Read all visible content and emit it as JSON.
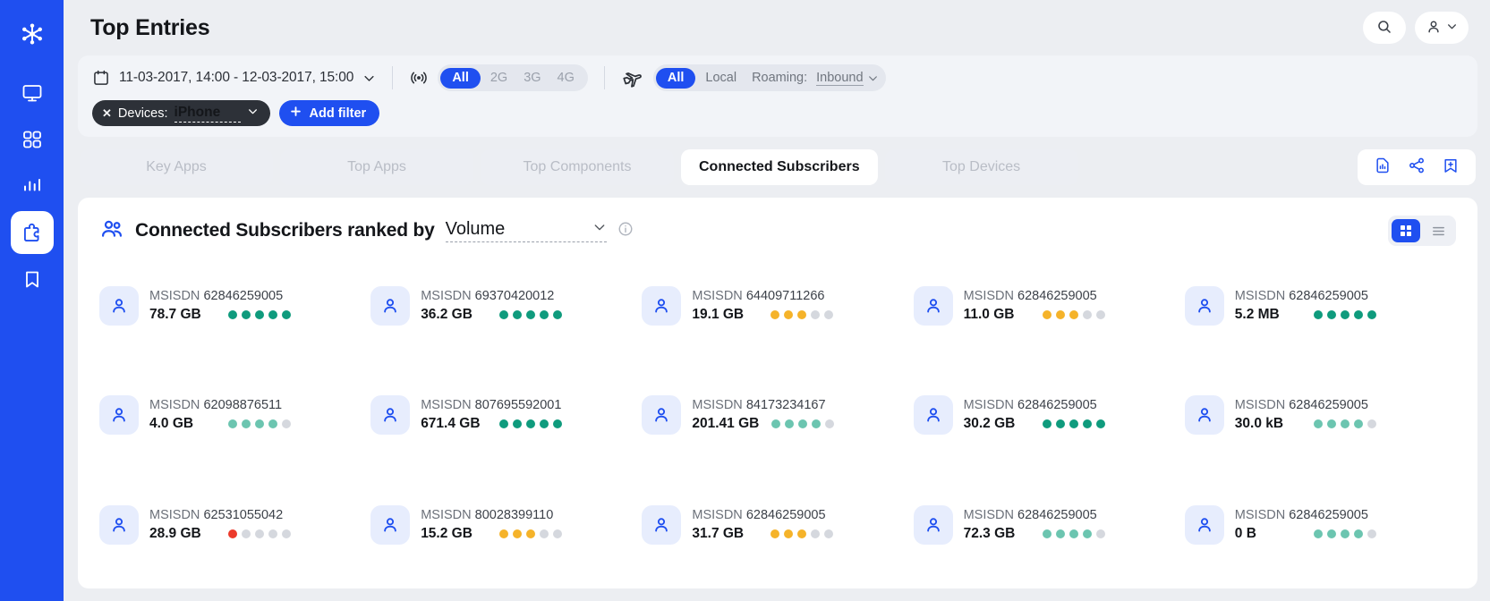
{
  "colors": {
    "brand": "#1f4ff0",
    "dot_green": "#0f9b7d",
    "dot_teal": "#6cc5b0",
    "dot_orange": "#f5b32a",
    "dot_red": "#ec3a2b",
    "dot_grey": "#d5d8de"
  },
  "rail": {
    "items": [
      {
        "name": "logo",
        "icon": "network-logo-icon"
      },
      {
        "name": "monitor",
        "icon": "monitor-icon"
      },
      {
        "name": "dashboard",
        "icon": "dashboard-grid-icon"
      },
      {
        "name": "analytics",
        "icon": "bar-chart-icon"
      },
      {
        "name": "top-entries",
        "icon": "puzzle-icon"
      },
      {
        "name": "bookmarks",
        "icon": "bookmark-icon"
      }
    ],
    "active_index": 4
  },
  "header": {
    "title": "Top Entries",
    "search_icon": "search-icon",
    "user_icon": "user-icon",
    "user_chevron": "chevron-down-icon"
  },
  "filters": {
    "calendar_icon": "calendar-icon",
    "date_range": "11-03-2017, 14:00 - 12-03-2017, 15:00",
    "date_chevron": "chevron-down-icon",
    "network_icon": "signal-radio-icon",
    "network_options": [
      "All",
      "2G",
      "3G",
      "4G"
    ],
    "network_selected": "All",
    "roaming_icon": "airplane-icon",
    "roaming_options": [
      "All",
      "Local"
    ],
    "roaming_selected": "All",
    "roaming_label": "Roaming:",
    "roaming_value": "Inbound",
    "roaming_chevron": "chevron-down-icon",
    "chip": {
      "close_icon": "close-icon",
      "label": "Devices:",
      "value": "iPhone",
      "chevron": "chevron-down-icon"
    },
    "add_filter": {
      "plus_icon": "plus-icon",
      "label": "Add filter"
    }
  },
  "tabs": {
    "items": [
      {
        "label": "Key Apps",
        "active": false
      },
      {
        "label": "Top Apps",
        "active": false
      },
      {
        "label": "Top Components",
        "active": false
      },
      {
        "label": "Connected Subscribers",
        "active": true
      },
      {
        "label": "Top Devices",
        "active": false
      }
    ],
    "tools": [
      {
        "name": "export-report-icon"
      },
      {
        "name": "share-icon"
      },
      {
        "name": "save-bookmark-icon"
      }
    ]
  },
  "card": {
    "icon": "subscribers-icon",
    "title": "Connected Subscribers ranked by",
    "rank_by": "Volume",
    "rank_chevron": "chevron-down-icon",
    "info_icon": "info-icon",
    "view_grid_icon": "grid-view-icon",
    "view_list_icon": "list-view-icon",
    "view_selected": "grid",
    "msisdn_label": "MSISDN",
    "entries": [
      {
        "msisdn": "62846259005",
        "value": "78.7 GB",
        "dots": [
          "green",
          "green",
          "green",
          "green",
          "green"
        ]
      },
      {
        "msisdn": "69370420012",
        "value": "36.2 GB",
        "dots": [
          "green",
          "green",
          "green",
          "green",
          "green"
        ]
      },
      {
        "msisdn": "64409711266",
        "value": "19.1 GB",
        "dots": [
          "orange",
          "orange",
          "orange",
          "grey",
          "grey"
        ]
      },
      {
        "msisdn": "62846259005",
        "value": "11.0 GB",
        "dots": [
          "orange",
          "orange",
          "orange",
          "grey",
          "grey"
        ]
      },
      {
        "msisdn": "62846259005",
        "value": "5.2 MB",
        "dots": [
          "green",
          "green",
          "green",
          "green",
          "green"
        ]
      },
      {
        "msisdn": "62098876511",
        "value": "4.0 GB",
        "dots": [
          "teal",
          "teal",
          "teal",
          "teal",
          "grey"
        ]
      },
      {
        "msisdn": "807695592001",
        "value": "671.4 GB",
        "dots": [
          "green",
          "green",
          "green",
          "green",
          "green"
        ]
      },
      {
        "msisdn": "84173234167",
        "value": "201.41 GB",
        "dots": [
          "teal",
          "teal",
          "teal",
          "teal",
          "grey"
        ]
      },
      {
        "msisdn": "62846259005",
        "value": "30.2 GB",
        "dots": [
          "green",
          "green",
          "green",
          "green",
          "green"
        ]
      },
      {
        "msisdn": "62846259005",
        "value": "30.0 kB",
        "dots": [
          "teal",
          "teal",
          "teal",
          "teal",
          "grey"
        ]
      },
      {
        "msisdn": "62531055042",
        "value": "28.9 GB",
        "dots": [
          "red",
          "grey",
          "grey",
          "grey",
          "grey"
        ]
      },
      {
        "msisdn": "80028399110",
        "value": "15.2 GB",
        "dots": [
          "orange",
          "orange",
          "orange",
          "grey",
          "grey"
        ]
      },
      {
        "msisdn": "62846259005",
        "value": "31.7 GB",
        "dots": [
          "orange",
          "orange",
          "orange",
          "grey",
          "grey"
        ]
      },
      {
        "msisdn": "62846259005",
        "value": "72.3 GB",
        "dots": [
          "teal",
          "teal",
          "teal",
          "teal",
          "grey"
        ]
      },
      {
        "msisdn": "62846259005",
        "value": "0 B",
        "dots": [
          "teal",
          "teal",
          "teal",
          "teal",
          "grey"
        ]
      }
    ]
  }
}
